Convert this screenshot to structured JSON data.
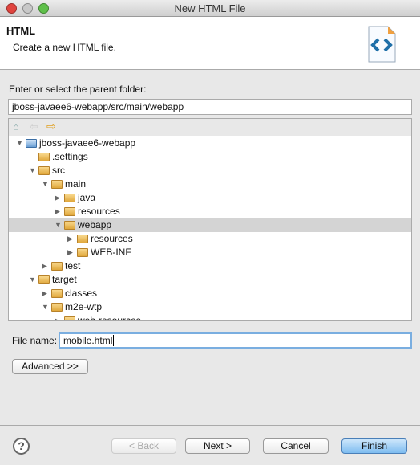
{
  "window": {
    "title": "New HTML File"
  },
  "header": {
    "title": "HTML",
    "description": "Create a new HTML file.",
    "icon": "html-file-icon"
  },
  "folder": {
    "label": "Enter or select the parent folder:",
    "value": "jboss-javaee6-webapp/src/main/webapp"
  },
  "tree": {
    "toolbar_icons": [
      "home-icon",
      "back-arrow-icon",
      "forward-arrow-icon"
    ],
    "items": [
      {
        "label": "jboss-javaee6-webapp",
        "level": 0,
        "state": "expanded",
        "project": true
      },
      {
        "label": ".settings",
        "level": 1,
        "state": "leaf"
      },
      {
        "label": "src",
        "level": 1,
        "state": "expanded"
      },
      {
        "label": "main",
        "level": 2,
        "state": "expanded"
      },
      {
        "label": "java",
        "level": 3,
        "state": "collapsed"
      },
      {
        "label": "resources",
        "level": 3,
        "state": "collapsed"
      },
      {
        "label": "webapp",
        "level": 3,
        "state": "expanded",
        "selected": true
      },
      {
        "label": "resources",
        "level": 4,
        "state": "collapsed"
      },
      {
        "label": "WEB-INF",
        "level": 4,
        "state": "collapsed"
      },
      {
        "label": "test",
        "level": 2,
        "state": "collapsed"
      },
      {
        "label": "target",
        "level": 1,
        "state": "expanded"
      },
      {
        "label": "classes",
        "level": 2,
        "state": "collapsed"
      },
      {
        "label": "m2e-wtp",
        "level": 2,
        "state": "expanded"
      },
      {
        "label": "web-resources",
        "level": 3,
        "state": "collapsed"
      }
    ]
  },
  "filename": {
    "label": "File name:",
    "value": "mobile.html"
  },
  "buttons": {
    "advanced": "Advanced >>",
    "back": "< Back",
    "next": "Next >",
    "cancel": "Cancel",
    "finish": "Finish"
  },
  "colors": {
    "accent": "#4a90d9",
    "selection": "#d4d4d4"
  }
}
